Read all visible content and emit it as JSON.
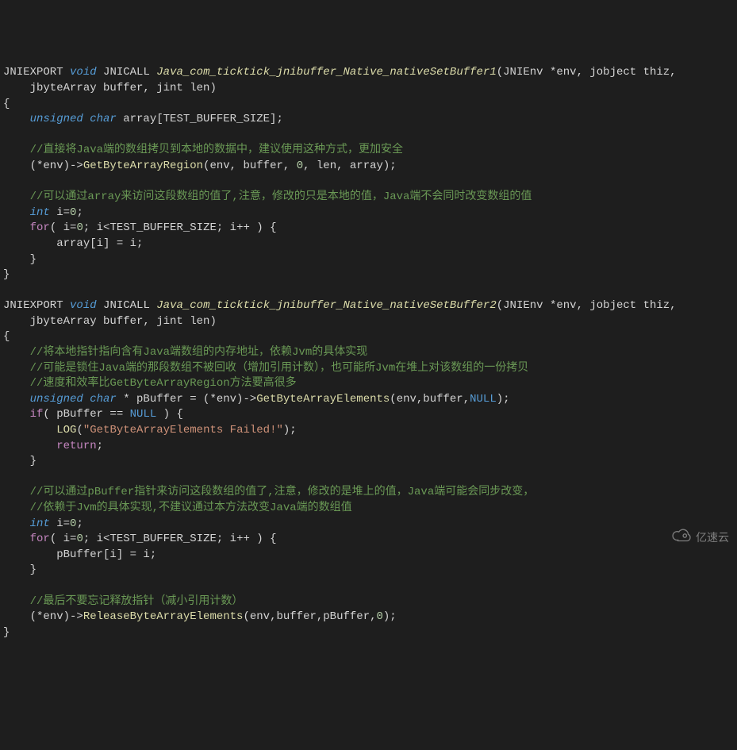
{
  "fn1": {
    "export": "JNIEXPORT",
    "rettype": "void",
    "jnicall": "JNICALL",
    "name": "Java_com_ticktick_jnibuffer_Native_nativeSetBuffer1",
    "params": "(JNIEnv *env, jobject thiz,",
    "params2": "    jbyteArray buffer, jint len)",
    "open": "{",
    "line_decl_type": "unsigned char",
    "line_decl_rest": " array[TEST_BUFFER_SIZE];",
    "c1": "//直接将Java端的数组拷贝到本地的数据中，建议使用这种方式，更加安全",
    "call_pre": "    (*env)->",
    "call_fn": "GetByteArrayRegion",
    "call_args": "(env, buffer, ",
    "call_zero": "0",
    "call_args2": ", len, array);",
    "c2": "//可以通过array来访问这段数组的值了,注意，修改的只是本地的值，Java端不会同时改变数组的值",
    "int_kw": "int",
    "int_rest": " i=",
    "int_zero": "0",
    "int_semi": ";",
    "for_kw": "for",
    "for_args_a": "( i=",
    "for_args_b": "; i<TEST_BUFFER_SIZE; i++ ) {",
    "loop_body": "        array[i] = i;",
    "loop_close": "    }",
    "close": "}"
  },
  "fn2": {
    "export": "JNIEXPORT",
    "rettype": "void",
    "jnicall": "JNICALL",
    "name": "Java_com_ticktick_jnibuffer_Native_nativeSetBuffer2",
    "params": "(JNIEnv *env, jobject thiz,",
    "params2": "    jbyteArray buffer, jint len)",
    "open": "{",
    "c1": "//将本地指针指向含有Java端数组的内存地址，依赖Jvm的具体实现",
    "c2": "//可能是锁住Java端的那段数组不被回收（增加引用计数），也可能所Jvm在堆上对该数组的一份拷贝",
    "c3": "//速度和效率比GetByteArrayRegion方法要高很多",
    "decl_type": "unsigned char",
    "decl_rest": " * pBuffer = (*env)->",
    "decl_fn": "GetByteArrayElements",
    "decl_args": "(env,buffer,",
    "decl_null": "NULL",
    "decl_end": ");",
    "if_kw": "if",
    "if_cond_a": "( pBuffer == ",
    "if_cond_null": "NULL",
    "if_cond_b": " ) {",
    "log_fn": "LOG",
    "log_open": "(",
    "log_str": "\"GetByteArrayElements Failed!\"",
    "log_close": ");",
    "return_kw": "return",
    "return_semi": ";",
    "if_close": "    }",
    "c4": "//可以通过pBuffer指针来访问这段数组的值了,注意，修改的是堆上的值，Java端可能会同步改变，",
    "c5": "//依赖于Jvm的具体实现,不建议通过本方法改变Java端的数组值",
    "int_kw": "int",
    "int_rest": " i=",
    "int_zero": "0",
    "int_semi": ";",
    "for_kw": "for",
    "for_args_a": "( i=",
    "for_args_b": "; i<TEST_BUFFER_SIZE; i++ ) {",
    "loop_body": "        pBuffer[i] = i;",
    "loop_close": "    }",
    "c6": "//最后不要忘记释放指针（减小引用计数）",
    "rel_pre": "    (*env)->",
    "rel_fn": "ReleaseByteArrayElements",
    "rel_args": "(env,buffer,pBuffer,",
    "rel_zero": "0",
    "rel_end": ");",
    "close": "}"
  },
  "watermark": "亿速云",
  "chart_data": {
    "type": "table",
    "note": "This image is a code screenshot, not a chart; chart_data is empty."
  }
}
